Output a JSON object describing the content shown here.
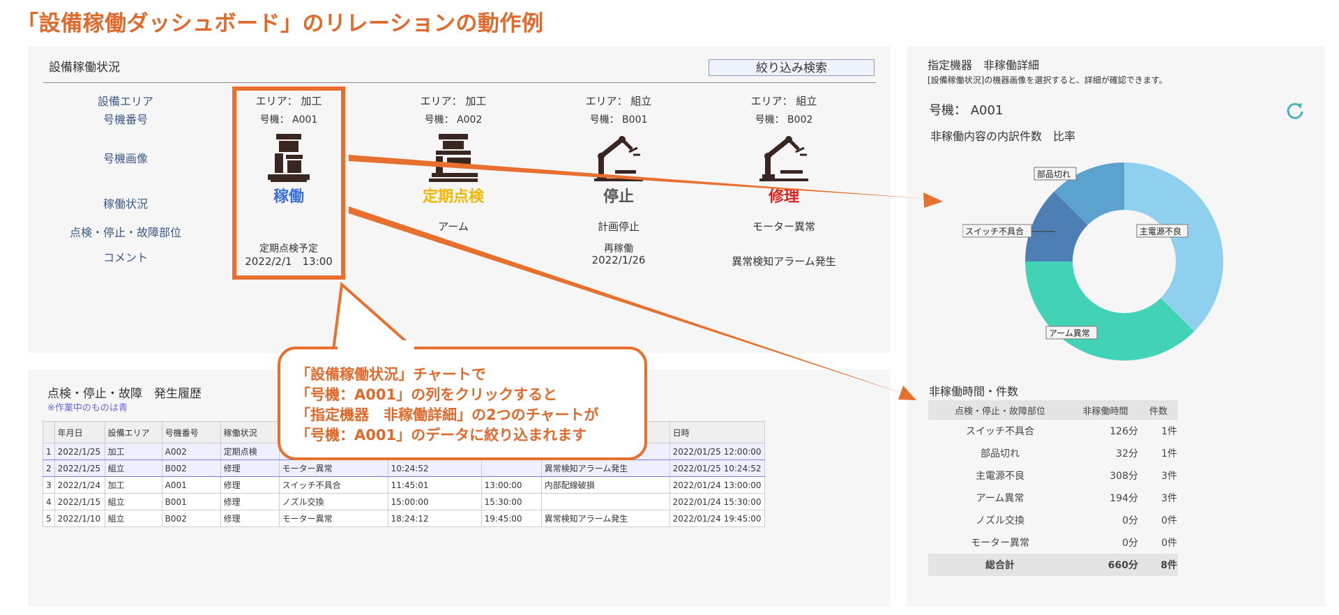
{
  "title": "「設備稼働ダッシュボード」のリレーションの動作例",
  "status_panel": {
    "title": "設備稼働状況",
    "filter_button": "絞り込み検索",
    "row_labels": [
      "設備エリア",
      "号機番号",
      "号機画像",
      "稼働状況",
      "点検・停止・故障部位",
      "コメント"
    ],
    "columns": [
      {
        "area": "エリア： 加工",
        "unit": "号機： A001",
        "icon": "press-machine-icon",
        "status": "稼働",
        "status_color": "#3a6fd8",
        "part": "",
        "comment1": "定期点検予定",
        "comment2": "2022/2/1　13:00"
      },
      {
        "area": "エリア： 加工",
        "unit": "号機： A002",
        "icon": "press-machine-icon",
        "status": "定期点検",
        "status_color": "#f0b800",
        "part": "アーム",
        "comment1": "",
        "comment2": ""
      },
      {
        "area": "エリア： 組立",
        "unit": "号機： B001",
        "icon": "robot-arm-icon",
        "status": "停止",
        "status_color": "#555555",
        "part": "計画停止",
        "comment1": "再稼働",
        "comment2": "2022/1/26"
      },
      {
        "area": "エリア： 組立",
        "unit": "号機： B002",
        "icon": "robot-arm-icon",
        "status": "修理",
        "status_color": "#e0201a",
        "part": "モーター異常",
        "comment1": "",
        "comment2": "異常検知アラーム発生"
      }
    ]
  },
  "history_panel": {
    "title": "点検・停止・故障　発生履歴",
    "note": "※作業中のものは青",
    "headers": [
      "",
      "年月日",
      "設備エリア",
      "号機番号",
      "稼働状況",
      "",
      "",
      "",
      "",
      "日時"
    ],
    "rows": [
      [
        "1",
        "2022/1/25",
        "加工",
        "A002",
        "定期点検",
        "",
        "",
        "",
        "",
        "2022/01/25 12:00:00"
      ],
      [
        "2",
        "2022/1/25",
        "組立",
        "B002",
        "修理",
        "モーター異常",
        "10:24:52",
        "",
        "異常検知アラーム発生",
        "2022/01/25 10:24:52"
      ],
      [
        "3",
        "2022/1/24",
        "加工",
        "A001",
        "修理",
        "スイッチ不具合",
        "11:45:01",
        "13:00:00",
        "内部配線破損",
        "2022/01/24 13:00:00"
      ],
      [
        "4",
        "2022/1/15",
        "組立",
        "B001",
        "修理",
        "ノズル交換",
        "15:00:00",
        "15:30:00",
        "",
        "2022/01/24 15:30:00"
      ],
      [
        "5",
        "2022/1/10",
        "組立",
        "B002",
        "修理",
        "モーター異常",
        "18:24:12",
        "19:45:00",
        "異常検知アラーム発生",
        "2022/01/24 19:45:00"
      ]
    ]
  },
  "callout": {
    "lines": [
      "「設備稼働状況」チャートで",
      "「号機：A001」の列をクリックすると",
      "「指定機器　非稼働詳細」の2つのチャートが",
      "「号機：A001」のデータに絞り込まれます"
    ]
  },
  "detail_panel": {
    "title": "指定機器　非稼働詳細",
    "subtitle": "[設備稼働状況]の機器画像を選択すると、詳細が確認できます。",
    "unit": "号機： A001",
    "chart_title": "非稼働内容の内訳件数　比率",
    "table_title": "非稼働時間・件数",
    "table_headers": [
      "点検・停止・故障部位",
      "非稼働時間",
      "件数"
    ],
    "table_rows": [
      [
        "スイッチ不具合",
        "126分",
        "1件"
      ],
      [
        "部品切れ",
        "32分",
        "1件"
      ],
      [
        "主電源不良",
        "308分",
        "3件"
      ],
      [
        "アーム異常",
        "194分",
        "3件"
      ],
      [
        "ノズル交換",
        "0分",
        "0件"
      ],
      [
        "モーター異常",
        "0分",
        "0件"
      ]
    ],
    "total": [
      "総合計",
      "660分",
      "8件"
    ]
  },
  "chart_data": {
    "type": "pie",
    "title": "非稼働内容の内訳件数　比率",
    "categories": [
      "主電源不良",
      "アーム異常",
      "スイッチ不具合",
      "部品切れ"
    ],
    "values": [
      3,
      3,
      1,
      1
    ],
    "colors": [
      "#8fd0ef",
      "#42d3b7",
      "#4d7fb5",
      "#5ba3ce"
    ],
    "donut": true,
    "legend": "none"
  }
}
